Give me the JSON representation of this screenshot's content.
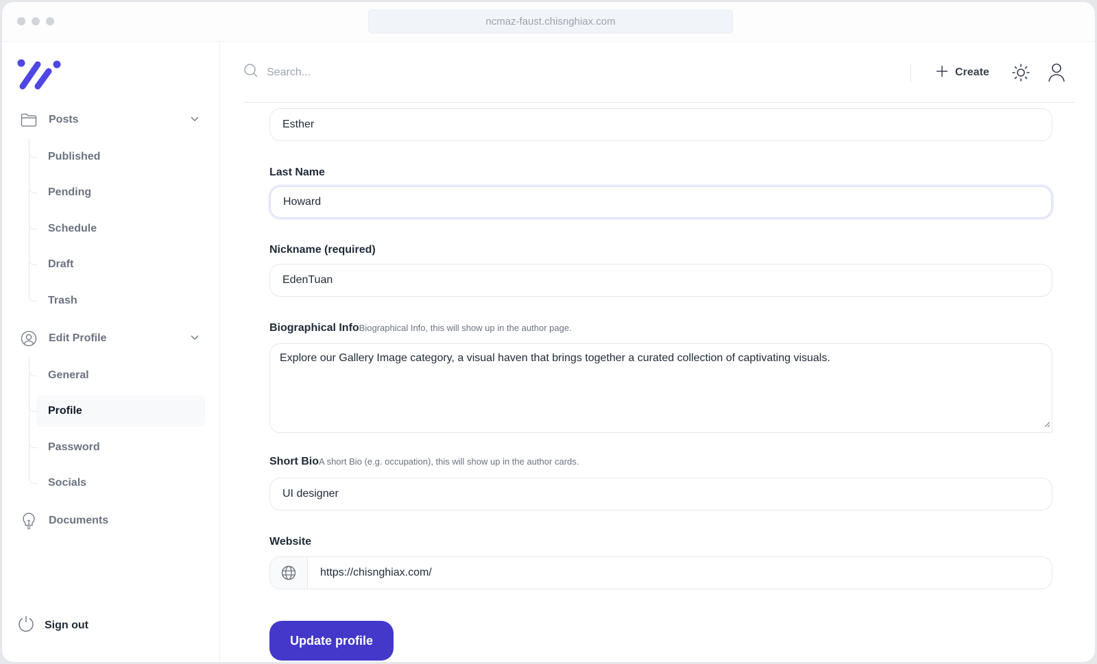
{
  "browser": {
    "url": "ncmaz-faust.chisnghiax.com"
  },
  "brand": {
    "logo": "logo-icon",
    "color": "#4f46e5"
  },
  "sidebar": {
    "groups": [
      {
        "label": "Posts",
        "icon": "folder-icon",
        "expanded": true,
        "items": [
          {
            "label": "Published"
          },
          {
            "label": "Pending"
          },
          {
            "label": "Schedule"
          },
          {
            "label": "Draft"
          },
          {
            "label": "Trash"
          }
        ]
      },
      {
        "label": "Edit Profile",
        "icon": "user-circle-icon",
        "expanded": true,
        "items": [
          {
            "label": "General"
          },
          {
            "label": "Profile",
            "active": true
          },
          {
            "label": "Password"
          },
          {
            "label": "Socials"
          }
        ]
      },
      {
        "label": "Documents",
        "icon": "lightbulb-icon"
      }
    ],
    "signout": {
      "label": "Sign out",
      "icon": "power-icon"
    }
  },
  "topbar": {
    "search_placeholder": "Search...",
    "create_label": "Create",
    "theme_icon": "sun-icon",
    "user_icon": "user-icon"
  },
  "form": {
    "first_name": {
      "value": "Esther"
    },
    "last_name": {
      "label": "Last Name",
      "value": "Howard"
    },
    "nickname": {
      "label": "Nickname (required)",
      "value": "EdenTuan"
    },
    "bio": {
      "label": "Biographical Info",
      "hint": "Biographical Info, this will show up in the author page.",
      "value": "Explore our Gallery Image category, a visual haven that brings together a curated collection of captivating visuals."
    },
    "short_bio": {
      "label": "Short Bio",
      "hint": "A short Bio (e.g. occupation), this will show up in the author cards.",
      "value": "UI designer"
    },
    "website": {
      "label": "Website",
      "value": "https://chisnghiax.com/",
      "icon": "globe-icon"
    },
    "submit_label": "Update profile",
    "accent": "#4338ca"
  }
}
